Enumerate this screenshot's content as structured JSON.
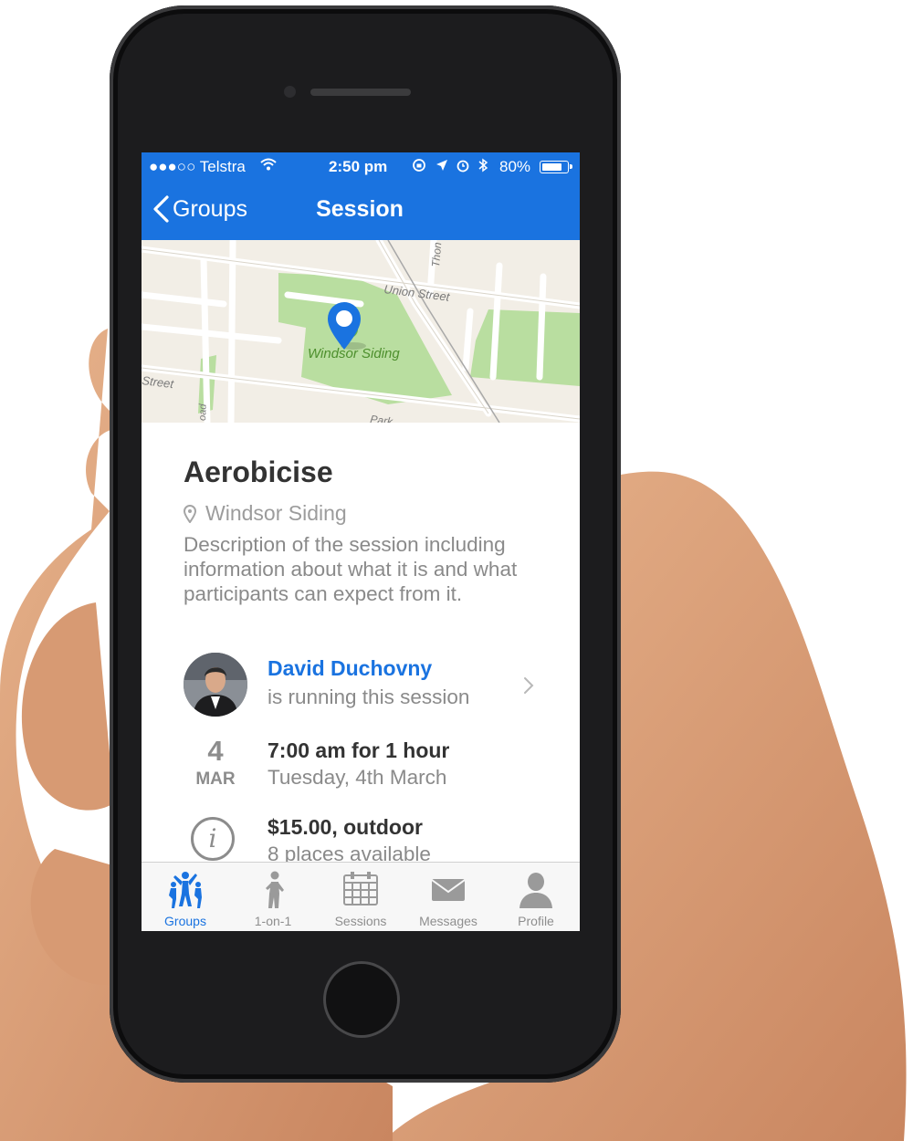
{
  "status_bar": {
    "carrier": "●●●○○ Telstra",
    "time": "2:50 pm",
    "battery": "80%",
    "battery_level": 0.8
  },
  "nav": {
    "back_label": "Groups",
    "title": "Session"
  },
  "map": {
    "streets": [
      "Union Street",
      "Street",
      "Thon",
      "Park",
      "oad"
    ],
    "place_label": "Windsor Siding"
  },
  "session": {
    "title": "Aerobicise",
    "location": "Windsor Siding",
    "description": "Description of the session including information about what it is and what participants can expect from it.",
    "host_name": "David Duchovny",
    "host_caption": "is running this session",
    "date_day": "4",
    "date_month": "MAR",
    "time_text": "7:00 am for 1 hour",
    "date_long": "Tuesday, 4th March",
    "price_text": "$15.00, outdoor",
    "places_text": "8 places available"
  },
  "tabs": [
    {
      "label": "Groups",
      "icon": "groups-icon",
      "active": true
    },
    {
      "label": "1-on-1",
      "icon": "one-on-one-icon",
      "active": false
    },
    {
      "label": "Sessions",
      "icon": "calendar-icon",
      "active": false
    },
    {
      "label": "Messages",
      "icon": "envelope-icon",
      "active": false
    },
    {
      "label": "Profile",
      "icon": "person-icon",
      "active": false
    }
  ],
  "colors": {
    "accent": "#1a73e0",
    "park": "#b9dea0",
    "map_bg": "#f2eee6"
  }
}
